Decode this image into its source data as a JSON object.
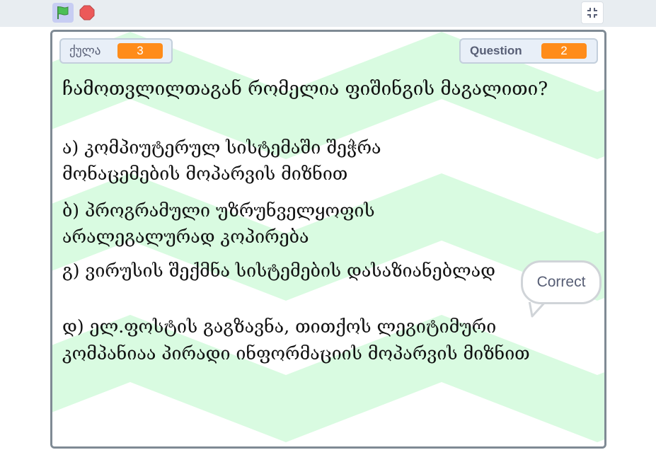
{
  "toolbar": {
    "green_flag_icon": "green-flag",
    "stop_icon": "stop-sign",
    "exit_fullscreen_icon": "exit-fullscreen"
  },
  "colors": {
    "monitor_value_bg": "#ff8c1a",
    "stage_stripe": "#d9fbe1",
    "flag_green": "#4cbf56",
    "stop_red": "#ec5959"
  },
  "monitors": {
    "score": {
      "label": "ქულა",
      "value": "3"
    },
    "question": {
      "label": "Question",
      "value": "2"
    }
  },
  "question": {
    "text": "ჩამოთვლილთაგან რომელია ფიშინგის მაგალითი?"
  },
  "answers": {
    "a_line1": "ა) კომპიუტერულ სისტემაში შეჭრა",
    "a_line2": "მონაცემების მოპარვის მიზნით",
    "b_line1": "ბ) პროგრამული უზრუნველყოფის",
    "b_line2": "არალეგალურად კოპირება",
    "c_line1": "გ) ვირუსის შექმნა სისტემების დასაზიანებლად",
    "d_line1": "დ) ელ.ფოსტის გაგზავნა, თითქოს ლეგიტიმური",
    "d_line2": "კომპანიაა პირადი ინფორმაციის მოპარვის მიზნით"
  },
  "speech_bubble": {
    "text": "Correct"
  }
}
